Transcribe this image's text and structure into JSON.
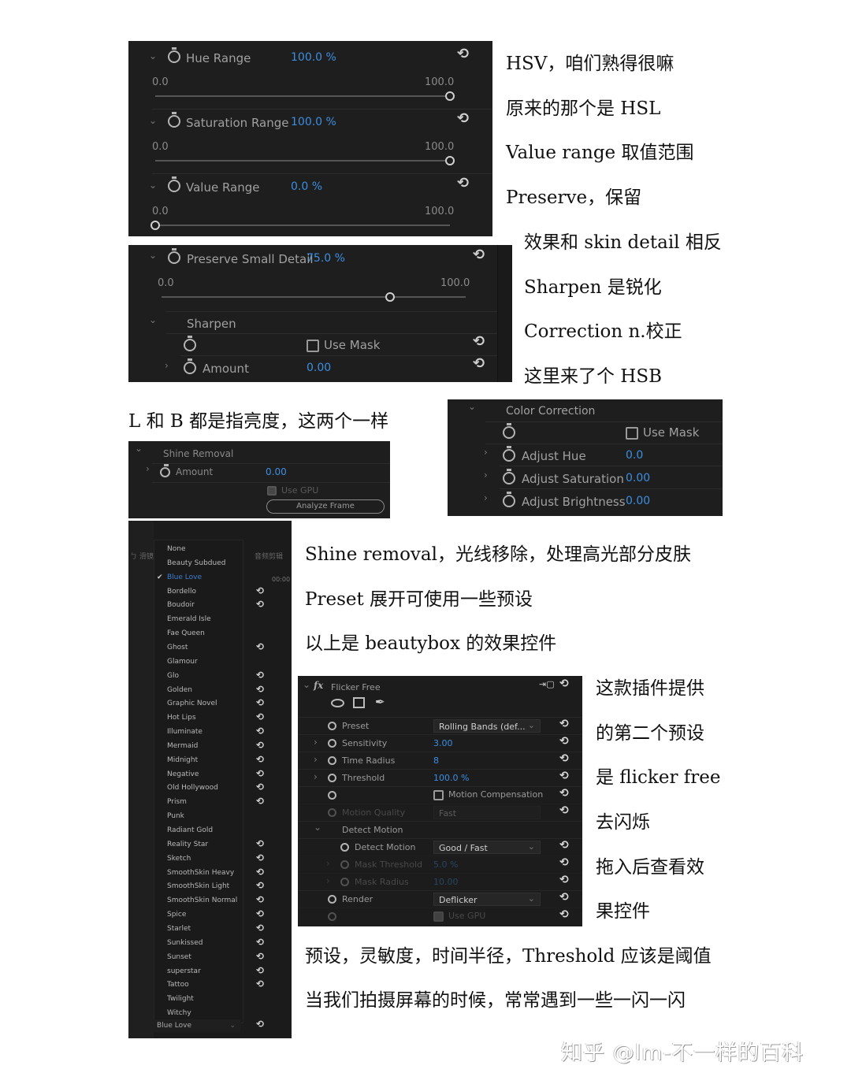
{
  "panel_hsv": {
    "rows": [
      {
        "label": "Hue Range",
        "value": "100.0 %",
        "min": "0.0",
        "max": "100.0",
        "fraction": 1.0
      },
      {
        "label": "Saturation Range",
        "value": "100.0 %",
        "min": "0.0",
        "max": "100.0",
        "fraction": 1.0
      },
      {
        "label": "Value Range",
        "value": "0.0 %",
        "min": "0.0",
        "max": "100.0",
        "fraction": 0.0
      }
    ]
  },
  "panel_detail": {
    "preserve": {
      "label": "Preserve Small Detail",
      "value": "75.0 %",
      "min": "0.0",
      "max": "100.0",
      "fraction": 0.75
    },
    "sharpen_group": "Sharpen",
    "use_mask": "Use Mask",
    "amount_label": "Amount",
    "amount_value": "0.00"
  },
  "panel_color": {
    "group": "Color Correction",
    "use_mask": "Use Mask",
    "rows": [
      {
        "label": "Adjust Hue",
        "value": "0.0"
      },
      {
        "label": "Adjust Saturation",
        "value": "0.00"
      },
      {
        "label": "Adjust Brightness",
        "value": "0.00"
      }
    ]
  },
  "panel_shine": {
    "group": "Shine Removal",
    "amount_label": "Amount",
    "amount_value": "0.00",
    "use_gpu": "Use GPU",
    "analyze_button": "Analyze Frame"
  },
  "preset_menu": {
    "items": [
      "None",
      "Beauty Subdued",
      "Blue Love",
      "Bordello",
      "Boudoir",
      "Emerald Isle",
      "Fae Queen",
      "Ghost",
      "Glamour",
      "Glo",
      "Golden",
      "Graphic Novel",
      "Hot Lips",
      "Illuminate",
      "Mermaid",
      "Midnight",
      "Negative",
      "Old Hollywood",
      "Prism",
      "Punk",
      "Radiant Gold",
      "Reality Star",
      "Sketch",
      "SmoothSkin Heavy",
      "SmoothSkin Light",
      "SmoothSkin Normal",
      "Spice",
      "Starlet",
      "Sunkissed",
      "Sunset",
      "superstar",
      "Tattoo",
      "Twilight",
      "Witchy"
    ],
    "selected": "Blue Love",
    "current_value": "Blue Love",
    "timecode": "00:00"
  },
  "panel_flicker": {
    "title": "Flicker Free",
    "rows": [
      {
        "label": "Preset",
        "type": "dropdown",
        "value": "Rolling Bands (def..."
      },
      {
        "label": "Sensitivity",
        "type": "value",
        "value": "3.00"
      },
      {
        "label": "Time Radius",
        "type": "value",
        "value": "8"
      },
      {
        "label": "Threshold",
        "type": "value",
        "value": "100.0 %"
      },
      {
        "label": "",
        "type": "checkbox",
        "value": "Motion Compensation"
      },
      {
        "label": "Motion Quality",
        "type": "dropdown-disabled",
        "value": "Fast"
      },
      {
        "label": "Detect Motion",
        "type": "group",
        "value": ""
      },
      {
        "label": "Detect Motion",
        "type": "dropdown",
        "value": "Good / Fast"
      },
      {
        "label": "Mask Threshold",
        "type": "value-disabled",
        "value": "5.0 %"
      },
      {
        "label": "Mask Radius",
        "type": "value-disabled",
        "value": "10.00"
      },
      {
        "label": "Render",
        "type": "dropdown",
        "value": "Deflicker"
      },
      {
        "label": "",
        "type": "checkbox-disabled",
        "value": "Use GPU"
      }
    ]
  },
  "notes": {
    "n1": "HSV，咱们熟得很嘛",
    "n2": "原来的那个是 HSL",
    "n3": "Value range 取值范围",
    "n4": "Preserve，保留",
    "n5": "效果和 skin detail 相反",
    "n6": "Sharpen 是锐化",
    "n7": "Correction n.校正",
    "n8": "这里来了个 HSB",
    "n9": "L 和 B 都是指亮度，这两个一样",
    "n10": "Shine removal，光线移除，处理高光部分皮肤",
    "n11": "Preset 展开可使用一些预设",
    "n12": "以上是 beautybox 的效果控件",
    "n13": "这款插件提供",
    "n14": "的第二个预设",
    "n15": "是 flicker free",
    "n16": "去闪烁",
    "n17": "拖入后查看效",
    "n18": "果控件",
    "n19": "预设，灵敏度，时间半径，Threshold 应该是阈值",
    "n20": "当我们拍摄屏幕的时候，常常遇到一些一闪一闪"
  },
  "watermark": "知乎 @lm-不一样的百科",
  "colors": {
    "panel_bg": "#1e1e1e",
    "value_blue": "#3c8ee0",
    "page_bg": "#ffffff"
  }
}
